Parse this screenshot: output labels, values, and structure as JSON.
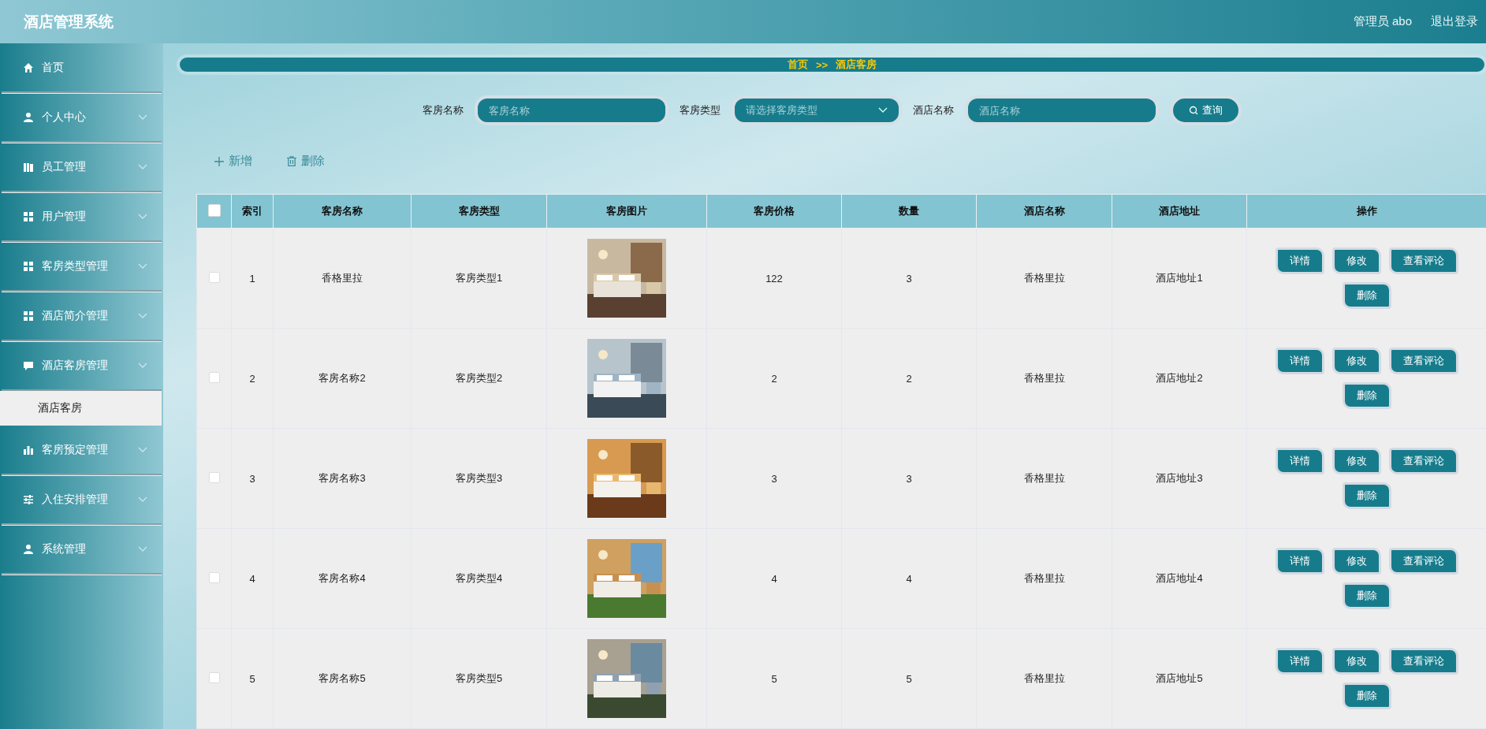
{
  "header": {
    "title": "酒店管理系统",
    "user": "管理员 abo",
    "logout": "退出登录"
  },
  "sidebar": {
    "items": [
      {
        "label": "首页",
        "has_arrow": false
      },
      {
        "label": "个人中心",
        "has_arrow": true
      },
      {
        "label": "员工管理",
        "has_arrow": true
      },
      {
        "label": "用户管理",
        "has_arrow": true
      },
      {
        "label": "客房类型管理",
        "has_arrow": true
      },
      {
        "label": "酒店简介管理",
        "has_arrow": true
      },
      {
        "label": "酒店客房管理",
        "has_arrow": true,
        "children": [
          {
            "label": "酒店客房",
            "selected": true
          }
        ]
      },
      {
        "label": "客房预定管理",
        "has_arrow": true
      },
      {
        "label": "入住安排管理",
        "has_arrow": true
      },
      {
        "label": "系统管理",
        "has_arrow": true
      }
    ]
  },
  "breadcrumb": {
    "home": "首页",
    "separator": ">>",
    "current": "酒店客房"
  },
  "search": {
    "fields": [
      {
        "kind": "input",
        "label": "客房名称",
        "placeholder": "客房名称"
      },
      {
        "kind": "select",
        "label": "客房类型",
        "placeholder": "请选择客房类型"
      },
      {
        "kind": "input",
        "label": "酒店名称",
        "placeholder": "酒店名称"
      }
    ],
    "button": "查询"
  },
  "toolbar": [
    {
      "kind": "add",
      "label": "新增"
    },
    {
      "kind": "delete",
      "label": "删除"
    }
  ],
  "table": {
    "select_all": {
      "checked": false
    },
    "columns": [
      "索引",
      "客房名称",
      "客房类型",
      "客房图片",
      "客房价格",
      "数量",
      "酒店名称",
      "酒店地址",
      "操作"
    ],
    "rows": [
      {
        "checked": false,
        "index": "1",
        "name": "香格里拉",
        "type": "客房类型1",
        "image": {
          "kind": "picture"
        },
        "price": "122",
        "quantity": "3",
        "hotel": "香格里拉",
        "address": "酒店地址1",
        "actions": [
          "详情",
          "修改",
          "查看评论",
          "删除"
        ]
      },
      {
        "checked": false,
        "index": "2",
        "name": "客房名称2",
        "type": "客房类型2",
        "image": {
          "kind": "picture"
        },
        "price": "2",
        "quantity": "2",
        "hotel": "香格里拉",
        "address": "酒店地址2",
        "actions": [
          "详情",
          "修改",
          "查看评论",
          "删除"
        ]
      },
      {
        "checked": false,
        "index": "3",
        "name": "客房名称3",
        "type": "客房类型3",
        "image": {
          "kind": "picture"
        },
        "price": "3",
        "quantity": "3",
        "hotel": "香格里拉",
        "address": "酒店地址3",
        "actions": [
          "详情",
          "修改",
          "查看评论",
          "删除"
        ]
      },
      {
        "checked": false,
        "index": "4",
        "name": "客房名称4",
        "type": "客房类型4",
        "image": {
          "kind": "picture"
        },
        "price": "4",
        "quantity": "4",
        "hotel": "香格里拉",
        "address": "酒店地址4",
        "actions": [
          "详情",
          "修改",
          "查看评论",
          "删除"
        ]
      },
      {
        "checked": false,
        "index": "5",
        "name": "客房名称5",
        "type": "客房类型5",
        "image": {
          "kind": "picture"
        },
        "price": "5",
        "quantity": "5",
        "hotel": "香格里拉",
        "address": "酒店地址5",
        "actions": [
          "详情",
          "修改",
          "查看评论",
          "删除"
        ]
      }
    ]
  }
}
